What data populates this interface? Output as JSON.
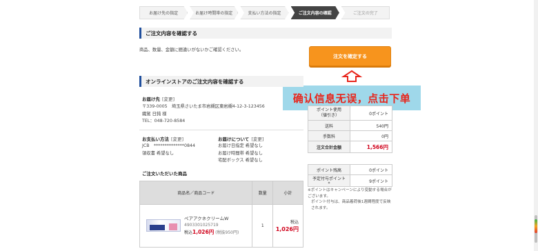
{
  "steps": [
    "お届け先の指定",
    "お届け時間帯の指定",
    "支払い方法の指定",
    "ご注文内容の確認",
    "ご注文の完了"
  ],
  "confirm_section": {
    "title": "ご注文内容を確認する",
    "note": "商品、数量、金額に間違いがないかご確認ください。",
    "order_button": "注文を確定する"
  },
  "annotation": "确认信息无误，点击下单",
  "store_section": {
    "title": "オンラインストアのご注文内容を確認する"
  },
  "delivery": {
    "title": "お届け先",
    "edit": "[変更]",
    "postal_address": "〒339-0005　埼玉県さいたま市岩槻区東岩槻4-12-3-123456",
    "name": "織駕 日鈍 様",
    "tel": "TEL：048-720-8584"
  },
  "payment": {
    "title": "お支払い方法",
    "edit": "[変更]",
    "card": "JCB　**************0844",
    "receipt": "領収書 希望なし"
  },
  "shipping": {
    "title": "お届けについて",
    "edit": "[変更]",
    "date": "お届け日指定 希望なし",
    "time": "お届け時間帯 希望なし",
    "box": "宅配ボックス 希望なし"
  },
  "products": {
    "title": "ご注文いただいた商品",
    "headers": [
      "商品名／商品コード",
      "数量",
      "小計"
    ],
    "items": [
      {
        "name": "ペアアクネクリームW",
        "code": "4903301025719",
        "tax_label": "税込",
        "price": "1,026円",
        "tax_excluded": "(税抜950円)",
        "qty": "1",
        "subtotal_label": "税込",
        "subtotal": "1,026円"
      }
    ]
  },
  "summary": {
    "rows": [
      {
        "label": "ポイント使用\n（値引き）",
        "value": "0ポイント"
      },
      {
        "label": "送料",
        "value": "540円"
      },
      {
        "label": "手数料",
        "value": "0円"
      },
      {
        "label": "注文合計金額",
        "value": "1,566円"
      }
    ]
  },
  "points": {
    "rows": [
      {
        "label": "ポイント残高",
        "value": "0ポイント"
      },
      {
        "label": "予定付与ポイント*",
        "value": "9ポイント"
      }
    ],
    "note_line1": "※ポイントはキャンペーンにより変動する場合がございます。",
    "note_line2": "ポイント付与は、商品着荷後1週間程度で反映されます。"
  },
  "colors": {
    "accent_blue": "#1f4e9c",
    "button_orange": "#f7941d",
    "price_red": "#d0021b",
    "annotation_bg": "#9fd8ea",
    "annotation_text": "#e8251b"
  }
}
